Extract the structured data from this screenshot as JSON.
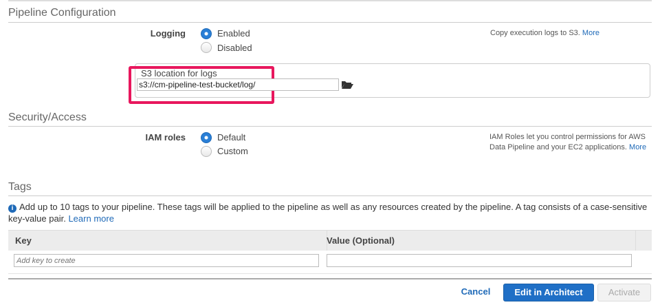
{
  "pipeline": {
    "title": "Pipeline Configuration",
    "logging_label": "Logging",
    "options": [
      "Enabled",
      "Disabled"
    ],
    "selected": "Enabled",
    "help": "Copy execution logs to S3.",
    "more": "More",
    "s3_label": "S3 location for logs",
    "s3_value": "s3://cm-pipeline-test-bucket/log/",
    "highlight_color": "#e8175d"
  },
  "security": {
    "title": "Security/Access",
    "iam_label": "IAM roles",
    "options": [
      "Default",
      "Custom"
    ],
    "selected": "Default",
    "help_line1": "IAM Roles let you control permissions for AWS",
    "help_line2": "Data Pipeline and your EC2 applications.",
    "more": "More"
  },
  "tags": {
    "title": "Tags",
    "info": "Add up to 10 tags to your pipeline. These tags will be applied to the pipeline as well as any resources created by the pipeline. A tag consists of a case-sensitive key-value pair.",
    "learn_more": "Learn more",
    "columns": [
      "Key",
      "Value (Optional)"
    ],
    "key_placeholder": "Add key to create",
    "value": ""
  },
  "footer": {
    "cancel": "Cancel",
    "edit": "Edit in Architect",
    "activate": "Activate"
  }
}
